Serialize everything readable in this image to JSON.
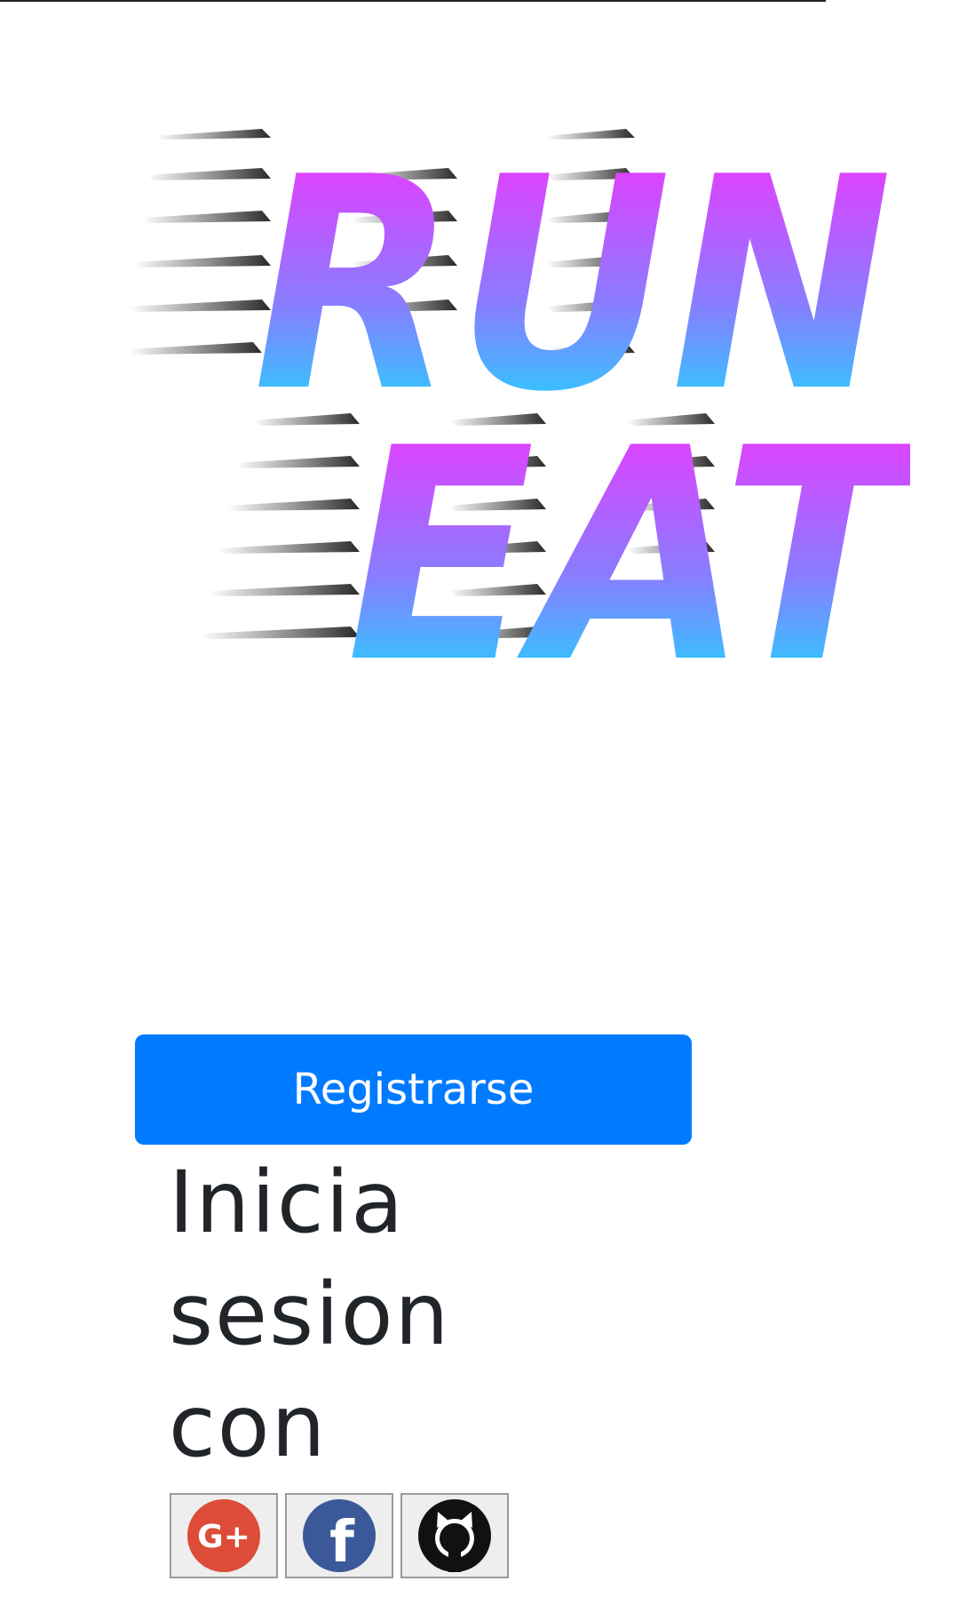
{
  "logo": {
    "line1": "RUN",
    "line2": "EAT"
  },
  "register_button": {
    "label": "Registrarse"
  },
  "login": {
    "title": "Inicia sesion con"
  },
  "social": [
    {
      "icon": "google-plus-icon",
      "label": "G+"
    },
    {
      "icon": "facebook-icon",
      "label": "f"
    },
    {
      "icon": "github-icon"
    }
  ],
  "colors": {
    "primary": "#007bff",
    "logo_top": "#ff2bff",
    "logo_bottom": "#00f0ff",
    "google": "#dd4b39",
    "facebook": "#3b5998"
  }
}
